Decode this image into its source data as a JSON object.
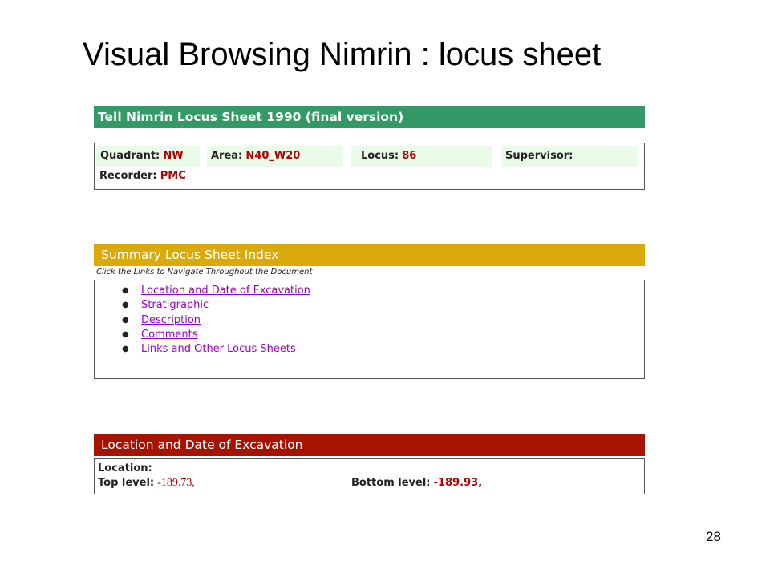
{
  "slide": {
    "title": "Visual Browsing Nimrin : locus sheet",
    "page_number": "28"
  },
  "header": {
    "title": "Tell Nimrin Locus Sheet 1990 (final version)",
    "color": "#339966"
  },
  "fields": {
    "quadrant": {
      "label": "Quadrant:",
      "value": "NW"
    },
    "area": {
      "label": "Area:",
      "value": "N40_W20"
    },
    "locus": {
      "label": "Locus:",
      "value": "86"
    },
    "supervisor": {
      "label": "Supervisor:",
      "value": ""
    },
    "recorder": {
      "label": "Recorder:",
      "value": "PMC"
    }
  },
  "index": {
    "title": "Summary Locus Sheet Index",
    "color": "#d9aa0a",
    "hint": "Click the Links to Navigate Throughout the Document",
    "links": [
      "Location and Date of Excavation",
      "Stratigraphic",
      "Description",
      "Comments",
      "Links and Other Locus Sheets"
    ]
  },
  "location": {
    "title": "Location and Date of Excavation",
    "color": "#a61300",
    "location_label": "Location:",
    "top_level_label": "Top level:",
    "top_level_value": "-189.73,",
    "bottom_level_label": "Bottom level:",
    "bottom_level_value": "-189.93,"
  }
}
